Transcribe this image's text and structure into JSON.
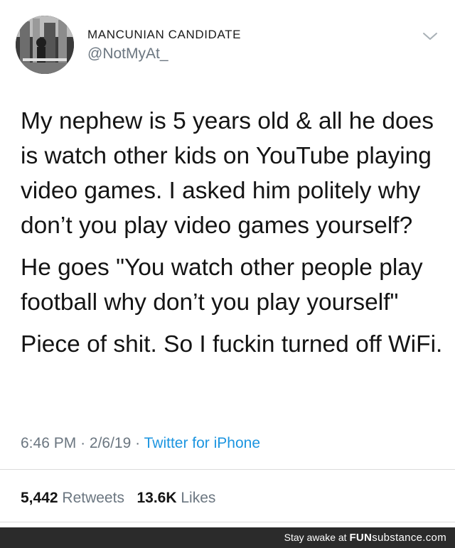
{
  "profile": {
    "display_name": "MANCUNIAN CANDIDATE",
    "handle": "@NotMyAt_",
    "avatar_icon": "profile-photo",
    "menu_icon": "chevron-down-icon"
  },
  "tweet": {
    "paragraphs": [
      "My nephew is 5 years old & all he does is watch other kids on YouTube playing video games. I asked him politely why don’t you play video games yourself?",
      "He goes \"You watch other people play football why don’t you play yourself\"",
      "Piece of shit. So I fuckin turned off WiFi."
    ]
  },
  "meta": {
    "time": "6:46 PM",
    "separator": "·",
    "date": "2/6/19",
    "source": "Twitter for iPhone"
  },
  "stats": {
    "retweets_count": "5,442",
    "retweets_label": "Retweets",
    "likes_count": "13.6K",
    "likes_label": "Likes"
  },
  "footer": {
    "text": "Stay awake at",
    "brand_bold": "FUN",
    "brand_rest": "substance",
    "brand_tld": ".com"
  },
  "colors": {
    "text": "#141414",
    "secondary": "#6b7680",
    "link": "#1c95e0",
    "footer_bg": "#2b2b2b"
  }
}
